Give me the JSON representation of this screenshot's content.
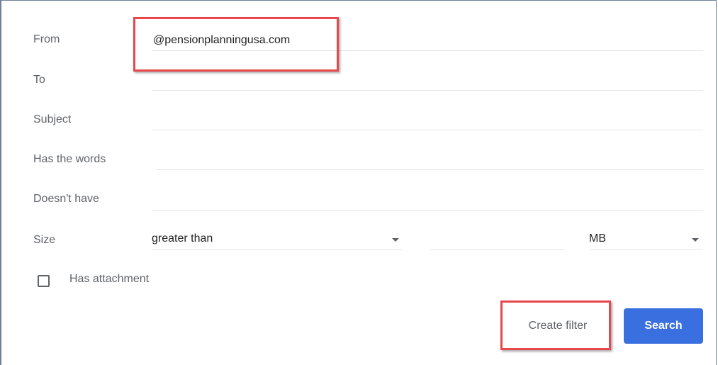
{
  "form": {
    "from": {
      "label": "From",
      "value": "@pensionplanningusa.com"
    },
    "to": {
      "label": "To",
      "value": ""
    },
    "subject": {
      "label": "Subject",
      "value": ""
    },
    "has_words": {
      "label": "Has the words",
      "value": ""
    },
    "doesnt_have": {
      "label": "Doesn't have",
      "value": ""
    },
    "size": {
      "label": "Size",
      "comparator": "greater than",
      "amount": "",
      "unit": "MB"
    },
    "has_attachment": {
      "label": "Has attachment",
      "checked": false
    }
  },
  "buttons": {
    "create_filter": "Create filter",
    "search": "Search"
  },
  "colors": {
    "primary": "#3a6fe0",
    "highlight": "#e8474c",
    "label": "#5f6368"
  }
}
